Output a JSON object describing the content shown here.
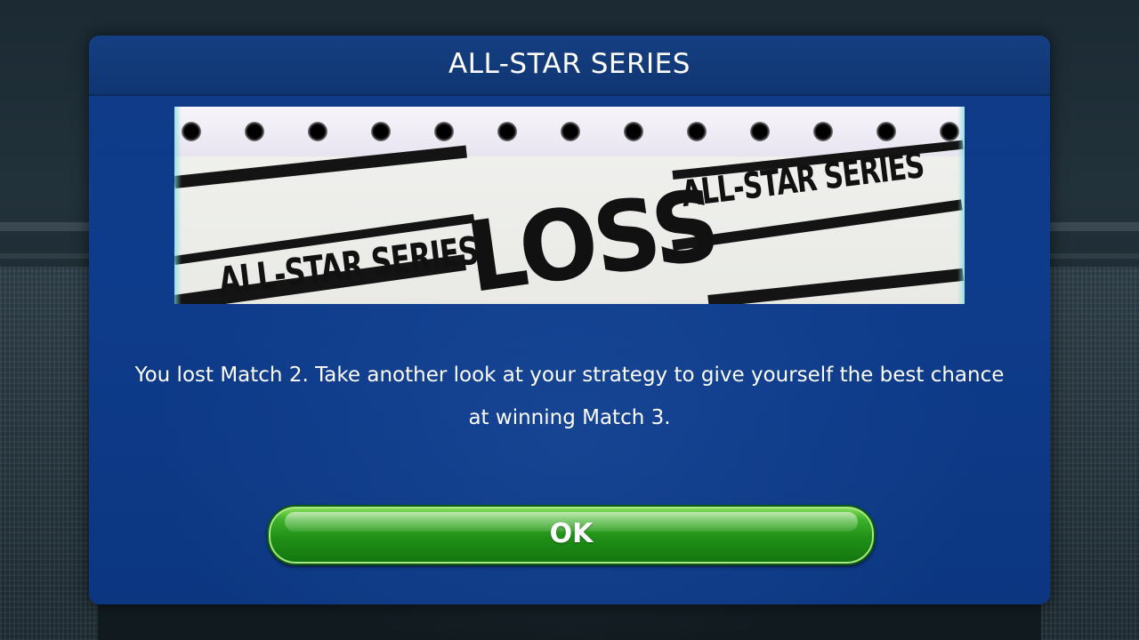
{
  "dialog": {
    "title": "ALL-STAR SERIES",
    "banner": {
      "headline": "LOSS",
      "series_label_left": "ALL-STAR SERIES",
      "series_label_right": "ALL-STAR SERIES"
    },
    "message": "You lost Match 2. Take another look at your strategy to give yourself the best chance at winning Match 3.",
    "ok_label": "OK"
  },
  "colors": {
    "dialog_bg": "#0e3c8c",
    "header_bg": "#103672",
    "button_green": "#1f8f17",
    "banner_bg": "#f1f2ef",
    "text": "#ffffff"
  }
}
